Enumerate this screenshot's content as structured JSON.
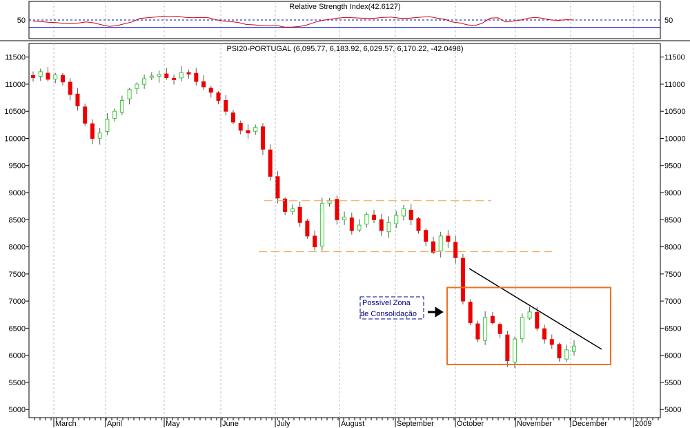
{
  "chart_data": [
    {
      "type": "line",
      "title": "Relative Strength Index(42.6127)",
      "ylim": [
        0,
        100
      ],
      "y_ticks": [
        50
      ],
      "reference_levels": [
        50,
        30
      ],
      "series": [
        {
          "values": [
            47,
            46,
            44,
            43,
            41,
            40,
            42,
            45,
            42,
            37,
            33,
            35,
            40,
            45,
            54,
            56,
            58,
            60,
            59,
            60,
            57,
            56,
            57,
            56,
            51,
            47,
            46,
            43,
            38,
            37,
            35,
            34,
            35,
            31,
            31,
            33,
            37,
            44,
            49,
            52,
            55,
            57,
            56,
            55,
            54,
            55,
            57,
            58,
            55,
            54,
            56,
            58,
            59,
            55,
            52,
            45,
            42,
            37,
            35,
            42,
            55,
            56,
            45,
            47,
            50,
            55,
            57,
            54,
            50,
            49,
            51,
            50
          ]
        }
      ],
      "colors": {
        "line": "#cc0000",
        "ref50": "#0000cc",
        "ref30": "#0000cc"
      }
    },
    {
      "type": "candlestick",
      "title": "PSI20-PORTUGAL (6,095.77, 6,183.92, 6,029.57, 6,170.22, -42.0498)",
      "ylim": [
        4850,
        11750
      ],
      "y_ticks": [
        5000,
        5500,
        6000,
        6500,
        7000,
        7500,
        8000,
        8500,
        9000,
        9500,
        10000,
        10500,
        11000,
        11500
      ],
      "x_labels": [
        "March",
        "April",
        "May",
        "June",
        "July",
        "August",
        "September",
        "October",
        "November",
        "December",
        "2009"
      ],
      "series": [
        {
          "name": "",
          "values": [
            11120,
            11230,
            11090,
            11170,
            11040,
            10810,
            10600,
            10280,
            10000,
            10100,
            10350,
            10500,
            10700,
            10900,
            11000,
            11100,
            11150,
            11180,
            11120,
            11100,
            11210,
            11190,
            11050,
            10950,
            10850,
            10700,
            10500,
            10300,
            10150,
            10100,
            10200,
            9800,
            9300,
            8900,
            8650,
            8700,
            8450,
            8200,
            8000,
            8800,
            8850,
            8500,
            8550,
            8300,
            8400,
            8600,
            8500,
            8300,
            8450,
            8580,
            8700,
            8500,
            8300,
            8100,
            7900,
            8200,
            8100,
            7800,
            7000,
            6600,
            6300,
            6700,
            6600,
            6400,
            5900,
            6300,
            6700,
            6800,
            6500,
            6300,
            6200,
            5950,
            6100,
            6170
          ]
        }
      ],
      "annotations": {
        "line1": "Possível Zona",
        "line2": "de Consolidação"
      },
      "colors": {
        "up": "#33cc33",
        "down": "#ee0000",
        "resistance": "#f0a040",
        "trendline": "#000000",
        "zone": "#f07020"
      }
    }
  ]
}
